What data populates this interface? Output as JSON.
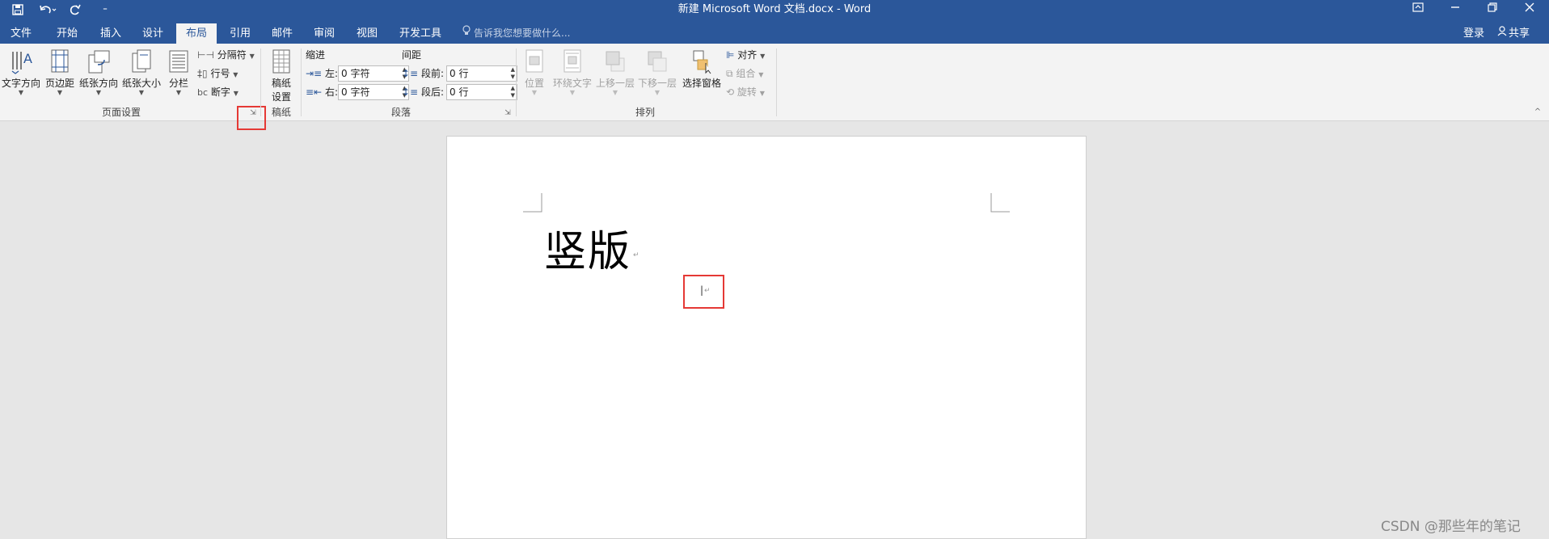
{
  "titlebar": {
    "title": "新建 Microsoft Word 文档.docx - Word",
    "customize_glyph": "⁼"
  },
  "tabs": [
    {
      "label": "文件",
      "active": false
    },
    {
      "label": "开始",
      "active": false
    },
    {
      "label": "插入",
      "active": false
    },
    {
      "label": "设计",
      "active": false
    },
    {
      "label": "布局",
      "active": true
    },
    {
      "label": "引用",
      "active": false
    },
    {
      "label": "邮件",
      "active": false
    },
    {
      "label": "审阅",
      "active": false
    },
    {
      "label": "视图",
      "active": false
    },
    {
      "label": "开发工具",
      "active": false
    }
  ],
  "tell_me": "告诉我您想要做什么...",
  "account": {
    "signin": "登录",
    "share": "共享"
  },
  "ribbon": {
    "page_setup": {
      "buttons": [
        "文字方向",
        "页边距",
        "纸张方向",
        "纸张大小",
        "分栏"
      ],
      "small": [
        "分隔符",
        "行号",
        "断字"
      ],
      "group_label": "页面设置"
    },
    "manuscript": {
      "button_line1": "稿纸",
      "button_line2": "设置",
      "group_label": "稿纸"
    },
    "paragraph": {
      "indent_label": "缩进",
      "spacing_label": "间距",
      "left_label": "左:",
      "right_label": "右:",
      "before_label": "段前:",
      "after_label": "段后:",
      "left_value": "0 字符",
      "right_value": "0 字符",
      "before_value": "0 行",
      "after_value": "0 行",
      "group_label": "段落"
    },
    "arrange": {
      "buttons": [
        "位置",
        "环绕文字",
        "上移一层",
        "下移一层",
        "选择窗格"
      ],
      "small": [
        "对齐",
        "组合",
        "旋转"
      ],
      "group_label": "排列"
    }
  },
  "document": {
    "heading": "竖版",
    "para_mark": "↵"
  },
  "watermark": "CSDN @那些年的笔记",
  "colors": {
    "accent": "#2b579a",
    "highlight": "#e53935"
  }
}
